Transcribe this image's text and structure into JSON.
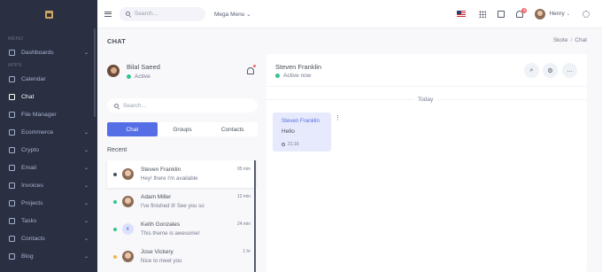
{
  "sidebar": {
    "sections": [
      {
        "title": "Menu"
      },
      {
        "title": "Apps"
      }
    ],
    "items": [
      {
        "label": "Dashboards",
        "icon": "home-icon",
        "has_chevron": true
      },
      {
        "label": "Calendar",
        "icon": "calendar-icon",
        "has_chevron": false
      },
      {
        "label": "Chat",
        "icon": "chat-icon",
        "has_chevron": false,
        "active": true
      },
      {
        "label": "File Manager",
        "icon": "file-icon",
        "has_chevron": false
      },
      {
        "label": "Ecommerce",
        "icon": "store-icon",
        "has_chevron": true
      },
      {
        "label": "Crypto",
        "icon": "bitcoin-icon",
        "has_chevron": true
      },
      {
        "label": "Email",
        "icon": "envelope-icon",
        "has_chevron": true
      },
      {
        "label": "Invoices",
        "icon": "receipt-icon",
        "has_chevron": true
      },
      {
        "label": "Projects",
        "icon": "briefcase-icon",
        "has_chevron": true
      },
      {
        "label": "Tasks",
        "icon": "task-icon",
        "has_chevron": true
      },
      {
        "label": "Contacts",
        "icon": "contacts-icon",
        "has_chevron": true
      },
      {
        "label": "Blog",
        "icon": "blog-icon",
        "has_chevron": true
      }
    ]
  },
  "topbar": {
    "search_placeholder": "Search...",
    "mega_menu": "Mega Menu",
    "notifications_count": "3",
    "user_name": "Henry"
  },
  "page": {
    "title": "CHAT",
    "breadcrumb": [
      "Skote",
      "Chat"
    ]
  },
  "me": {
    "name": "Bilal Saeed",
    "status": "Active"
  },
  "chat_search_placeholder": "Search...",
  "tabs": [
    "Chat",
    "Groups",
    "Contacts"
  ],
  "recent_label": "Recent",
  "chats": [
    {
      "name": "Steven Franklin",
      "message": "Hey! there I'm available",
      "time": "05 min",
      "status_color": "#495057",
      "avatar": "photo",
      "selected": true
    },
    {
      "name": "Adam Miller",
      "message": "I've finished it! See you so",
      "time": "12 min",
      "status_color": "#34c38f",
      "avatar": "photo",
      "selected": false
    },
    {
      "name": "Keith Gonzales",
      "message": "This theme is awesome!",
      "time": "24 min",
      "status_color": "#34c38f",
      "avatar": "K",
      "selected": false
    },
    {
      "name": "Jose Vickery",
      "message": "Nice to meet you",
      "time": "1 hr",
      "status_color": "#f1b44c",
      "avatar": "photo",
      "selected": false
    }
  ],
  "conversation": {
    "name": "Steven Franklin",
    "status": "Active now",
    "day_label": "Today",
    "messages": [
      {
        "sender": "Steven Franklin",
        "text": "Hello",
        "time": "21:16"
      }
    ]
  },
  "colors": {
    "accent": "#556ee6",
    "sidebar_bg": "#2a3042",
    "online": "#34c38f",
    "away": "#f1b44c",
    "danger": "#f46a6a"
  }
}
